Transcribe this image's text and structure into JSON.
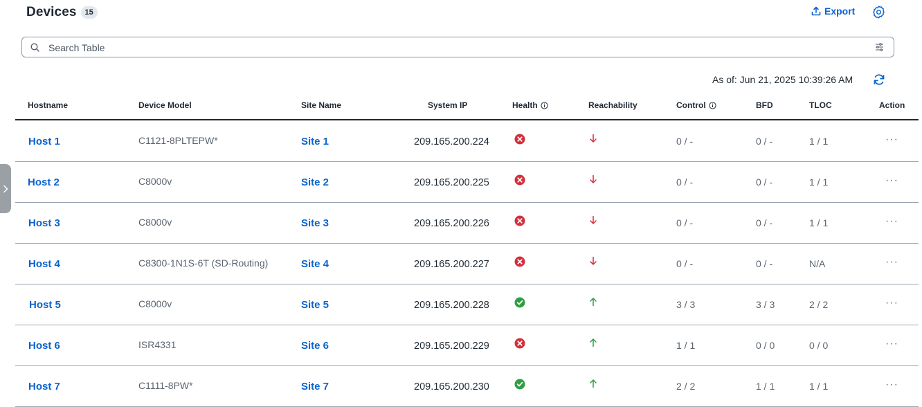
{
  "header": {
    "title": "Devices",
    "count": "15",
    "export_label": "Export"
  },
  "search": {
    "placeholder": "Search Table"
  },
  "as_of": "As of: Jun 21, 2025 10:39:26 AM",
  "columns": {
    "hostname": "Hostname",
    "model": "Device Model",
    "site": "Site Name",
    "ip": "System IP",
    "health": "Health",
    "reach": "Reachability",
    "control": "Control",
    "bfd": "BFD",
    "tloc": "TLOC",
    "action": "Action"
  },
  "colors": {
    "accent": "#0b63ce",
    "error": "#d32f3c",
    "ok": "#2f9e44",
    "down_arrow": "#d32f3c",
    "up_arrow": "#2f9e44"
  },
  "rows": [
    {
      "host": "Host 1",
      "model": "C1121-8PLTEPW*",
      "site": "Site 1",
      "ip": "209.165.200.224",
      "health": "error-icon",
      "reach": "down-arrow-icon",
      "control": "0 / -",
      "bfd": "0 / -",
      "tloc": "1 / 1",
      "action": "···"
    },
    {
      "host": "Host 2",
      "model": "C8000v",
      "site": "Site 2",
      "ip": "209.165.200.225",
      "health": "error-icon",
      "reach": "down-arrow-icon",
      "control": "0 / -",
      "bfd": "0 / -",
      "tloc": "1 / 1",
      "action": "···"
    },
    {
      "host": "Host 3",
      "model": "C8000v",
      "site": "Site 3",
      "ip": "209.165.200.226",
      "health": "error-icon",
      "reach": "down-arrow-icon",
      "control": "0 / -",
      "bfd": "0 / -",
      "tloc": "1 / 1",
      "action": "···"
    },
    {
      "host": "Host 4",
      "model": "C8300-1N1S-6T (SD-Routing)",
      "site": "Site 4",
      "ip": "209.165.200.227",
      "health": "error-icon",
      "reach": "down-arrow-icon",
      "control": "0 / -",
      "bfd": "0 / -",
      "tloc": "N/A",
      "action": "···"
    },
    {
      "host": "Host 5",
      "model": "C8000v",
      "site": "Site 5",
      "ip": "209.165.200.228",
      "health": "check-icon",
      "reach": "up-arrow-icon",
      "control": "3 / 3",
      "bfd": "3 / 3",
      "tloc": "2 / 2",
      "action": "···"
    },
    {
      "host": "Host 6",
      "model": "ISR4331",
      "site": "Site 6",
      "ip": "209.165.200.229",
      "health": "error-icon",
      "reach": "up-arrow-icon",
      "control": "1 / 1",
      "bfd": "0 / 0",
      "tloc": "0 / 0",
      "action": "···"
    },
    {
      "host": "Host 7",
      "model": "C1111-8PW*",
      "site": "Site 7",
      "ip": "209.165.200.230",
      "health": "check-icon",
      "reach": "up-arrow-icon",
      "control": "2 / 2",
      "bfd": "1 / 1",
      "tloc": "1 / 1",
      "action": "···"
    }
  ]
}
